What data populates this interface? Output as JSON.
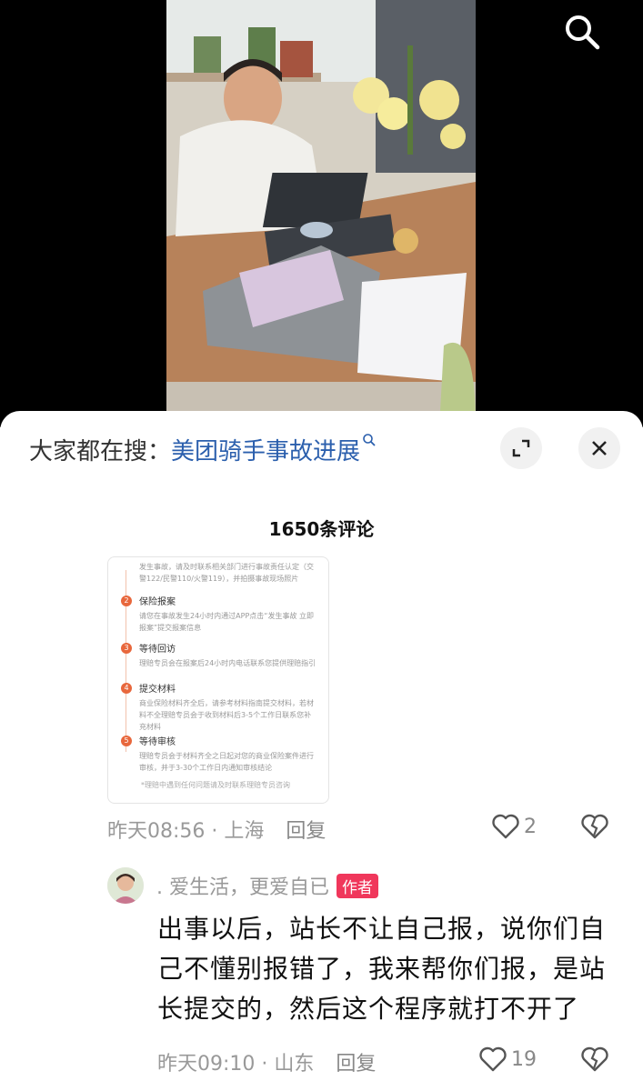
{
  "header": {
    "search_icon": "search-icon"
  },
  "hot_search": {
    "prefix": "大家都在搜：",
    "keyword": "美团骑手事故进展",
    "keyword_icon": "search-icon",
    "expand_icon": "expand-icon",
    "close_icon": "close-icon"
  },
  "comments_header": {
    "count_label": "1650条评论"
  },
  "image_card": {
    "step1_text": "发生事故，请及时联系相关部门进行事故责任认定（交警122/民警110/火警119），并拍摄事故现场照片",
    "step2_title": "保险报案",
    "step2_text": "请您在事故发生24小时内通过APP点击“发生事故 立即报案”提交报案信息",
    "step3_title": "等待回访",
    "step3_text": "理赔专员会在报案后24小时内电话联系您提供理赔指引",
    "step4_title": "提交材料",
    "step4_text": "商业保险材料齐全后，请参考材料指南提交材料，若材料不全理赔专员会于收到材料后3-5个工作日联系您补充材料",
    "step5_title": "等待审核",
    "step5_text": "理赔专员会于材料齐全之日起对您的商业保险案件进行审核，并于3-30个工作日内通知审核结论",
    "footer": "*理赔中遇到任何问题请及时联系理赔专员咨询"
  },
  "comment1": {
    "time_location": "昨天08:56 · 上海",
    "reply_label": "回复",
    "likes": "2",
    "like_icon": "heart-icon",
    "dislike_icon": "broken-heart-icon"
  },
  "comment2": {
    "username": ". 爱生活，更爱自已",
    "author_badge": "作者",
    "text": "出事以后，站长不让自己报，说你们自己不懂别报错了，我来帮你们报，是站长提交的，然后这个程序就打不开了",
    "time_location": "昨天09:10 · 山东",
    "reply_label": "回复",
    "likes": "19",
    "like_icon": "heart-icon",
    "dislike_icon": "broken-heart-icon"
  },
  "colors": {
    "keyword_blue": "#2b5fad",
    "author_badge_red": "#f0375b",
    "step_orange": "#e8673c"
  }
}
